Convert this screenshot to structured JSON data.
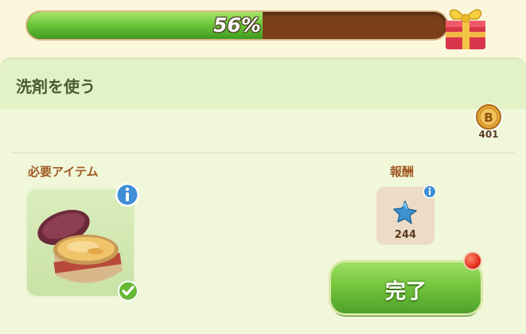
{
  "progress": {
    "percent_label": "56%",
    "value": 0.56
  },
  "task": {
    "title": "洗剤を使う"
  },
  "currency": {
    "coin_count": "401"
  },
  "required": {
    "label": "必要アイテム",
    "item_icon": "detergent-jar-icon",
    "status_icon": "checkmark-icon"
  },
  "reward": {
    "label": "報酬",
    "item_icon": "blue-star-icon",
    "count": "244"
  },
  "buttons": {
    "complete_label": "完了"
  },
  "colors": {
    "accent_green": "#6fc83b",
    "progress_track": "#7a3f18",
    "label_brown": "#a15a24",
    "notify_red": "#e02b1a"
  }
}
